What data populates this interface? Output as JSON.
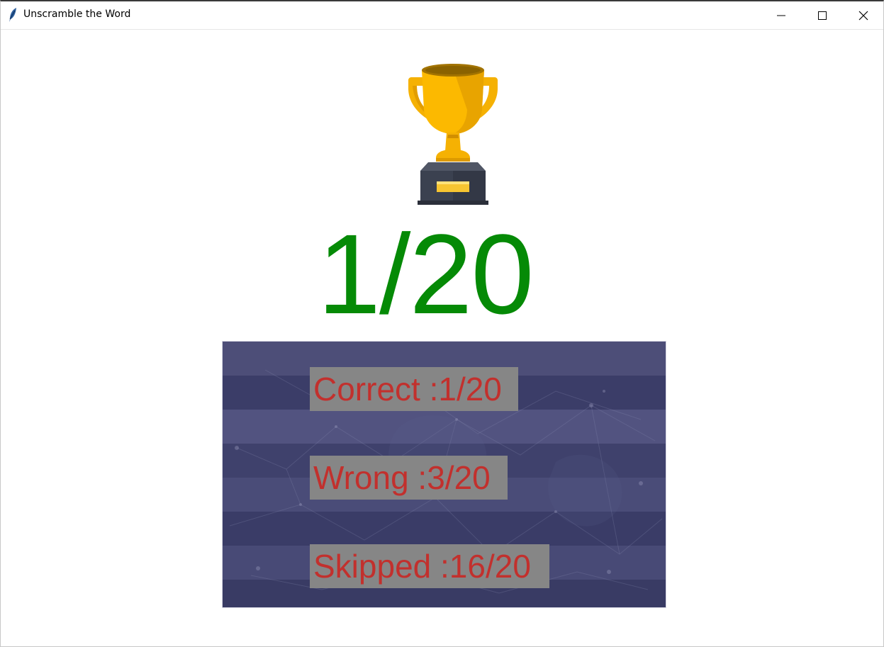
{
  "window": {
    "title": "Unscramble the Word",
    "app_icon": "feather-icon",
    "controls": {
      "minimize": "minimize-icon",
      "maximize": "maximize-icon",
      "close": "close-icon"
    }
  },
  "result": {
    "trophy_icon": "trophy-icon",
    "score": "1/20",
    "score_color": "#058a06"
  },
  "stats": {
    "correct": "Correct :1/20",
    "wrong": "Wrong :3/20",
    "skipped": "Skipped :16/20",
    "text_color": "#c2302d",
    "label_background": "#868686",
    "panel_background": "#3e3f69"
  }
}
